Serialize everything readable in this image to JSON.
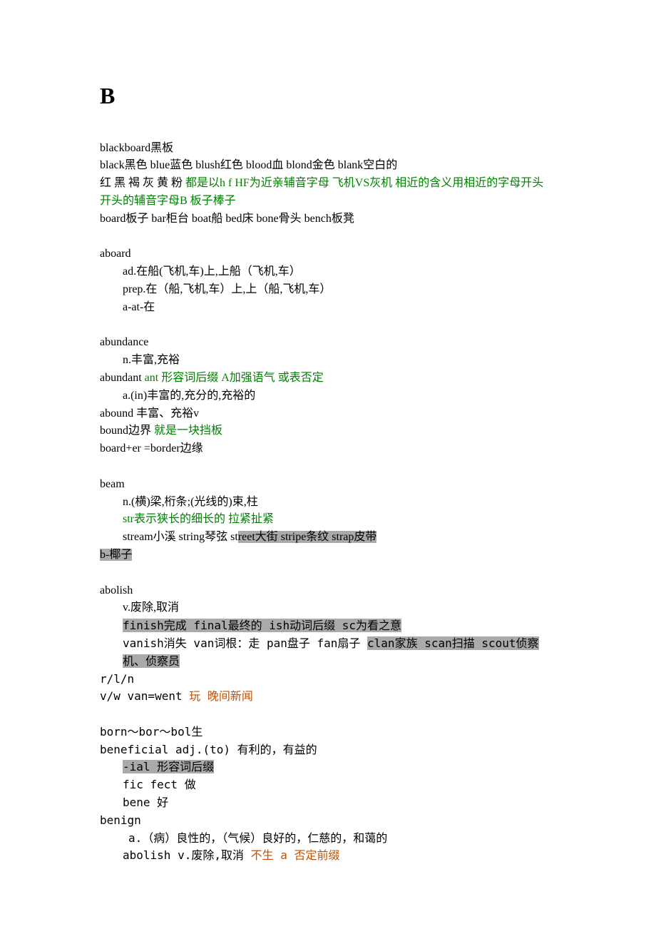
{
  "title": "B",
  "lines": [
    "blackboard黑板",
    "black黑色 blue蓝色 blush红色  blood血 blond金色 blank空白的",
    "开头的辅音字母B 板子棒子",
    "board板子 bar柜台 boat船 bed床  bone骨头 bench板凳",
    "aboard",
    "ad.在船(飞机,车)上,上船（飞机,车）",
    "prep.在（船,飞机,车）上,上（船,飞机,车）",
    "a-at-在",
    "abundance",
    "n.丰富,充裕",
    "a.(in)丰富的,充分的,充裕的",
    "abound 丰富、充裕v",
    "board+er =border边缘",
    "beam",
    "n.(横)梁,桁条;(光线的)束,柱",
    "abolish",
    "v.废除,取消",
    "r/l/n",
    "born～bor～bol生",
    "beneficial  adj.(to) 有利的，有益的",
    "fic   fect  做",
    "bene  好",
    "benign",
    "a.（病）良性的，（气候）良好的，仁慈的，和蔼的"
  ],
  "mixed": {
    "line3a": "红 黑 褐 灰 黄 粉 ",
    "line3b": "都是以h f HF为近亲辅音字母  飞机VS灰机 相近的含义用相近的字母开头",
    "abundant_a": "abundant ",
    "abundant_b": "ant 形容词后缀  A加强语气 或表否定",
    "bound_a": "bound边界  ",
    "bound_b": "就是一块挡板",
    "str": "str表示狭长的细长的   拉紧扯紧",
    "stream_a": "stream小溪 string琴弦 st",
    "stream_b": "reet大街 stripe条纹 strap皮带",
    "bsz": "b-椰子",
    "finish": "finish完成 final最终的 ish动词后缀 sc为看之意",
    "vanish_a": "vanish消失 van词根：走 pan盘子 fan扇子 ",
    "vanish_b": "clan家族 scan扫描 scout侦察机、侦察员",
    "vw_a": "v/w   van=went  ",
    "vw_b": "玩  晚间新闻",
    "ial_a": "-ial  形容词后缀",
    "abolish2_a": "abolish    v.废除,取消 ",
    "abolish2_b": "不生 a 否定前缀"
  }
}
